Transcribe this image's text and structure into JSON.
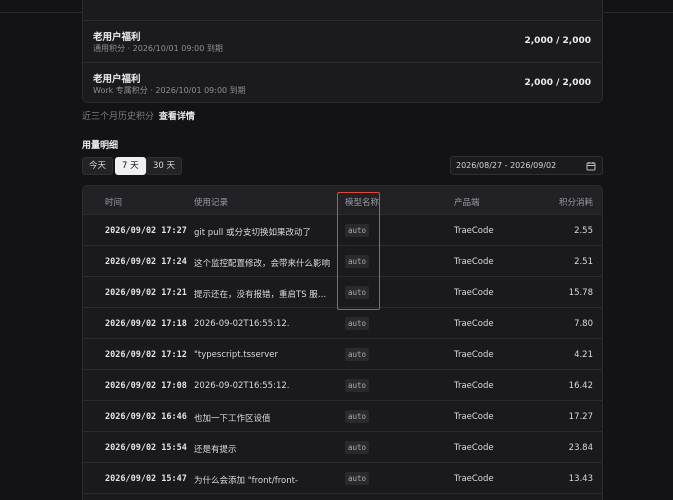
{
  "credits": [
    {
      "name": "老用户福利",
      "sub": "通用积分 · 2026/10/01 09:00 到期",
      "value": "2,000 / 2,000"
    },
    {
      "name": "老用户福利",
      "sub": "Work 专属积分 · 2026/10/01 09:00 到期",
      "value": "2,000 / 2,000"
    }
  ],
  "history": {
    "text": "近三个月历史积分",
    "link": "查看详情"
  },
  "usage": {
    "title": "用量明细",
    "ranges": [
      "今天",
      "7 天",
      "30 天"
    ],
    "active_range": "7 天",
    "date_range": "2026/08/27 - 2026/09/02"
  },
  "table": {
    "headers": [
      "时间",
      "使用记录",
      "模型名称",
      "产品端",
      "积分消耗"
    ],
    "rows": [
      {
        "time": "2026/09/02 17:27",
        "record": "git pull 或分支切换如果改动了",
        "model": "auto",
        "product": "TraeCode",
        "cost": "2.55"
      },
      {
        "time": "2026/09/02 17:24",
        "record": "这个监控配置修改，会带来什么影响",
        "model": "auto",
        "product": "TraeCode",
        "cost": "2.51"
      },
      {
        "time": "2026/09/02 17:21",
        "record": "提示还在，没有报错，重启TS 服务后",
        "model": "auto",
        "product": "TraeCode",
        "cost": "15.78"
      },
      {
        "time": "2026/09/02 17:18",
        "record": "2026-09-02T16:55:12.",
        "model": "auto",
        "product": "TraeCode",
        "cost": "7.80"
      },
      {
        "time": "2026/09/02 17:12",
        "record": "\"typescript.tsserver",
        "model": "auto",
        "product": "TraeCode",
        "cost": "4.21"
      },
      {
        "time": "2026/09/02 17:08",
        "record": "2026-09-02T16:55:12.",
        "model": "auto",
        "product": "TraeCode",
        "cost": "16.42"
      },
      {
        "time": "2026/09/02 16:46",
        "record": "也加一下工作区设值",
        "model": "auto",
        "product": "TraeCode",
        "cost": "17.27"
      },
      {
        "time": "2026/09/02 15:54",
        "record": "还是有提示",
        "model": "auto",
        "product": "TraeCode",
        "cost": "23.84"
      },
      {
        "time": "2026/09/02 15:47",
        "record": "为什么会添加 \"front/front-",
        "model": "auto",
        "product": "TraeCode",
        "cost": "13.43"
      }
    ]
  },
  "colors": {
    "highlight": "#e0483b",
    "active_btn": "#f0f0f2",
    "background": "#131315"
  }
}
